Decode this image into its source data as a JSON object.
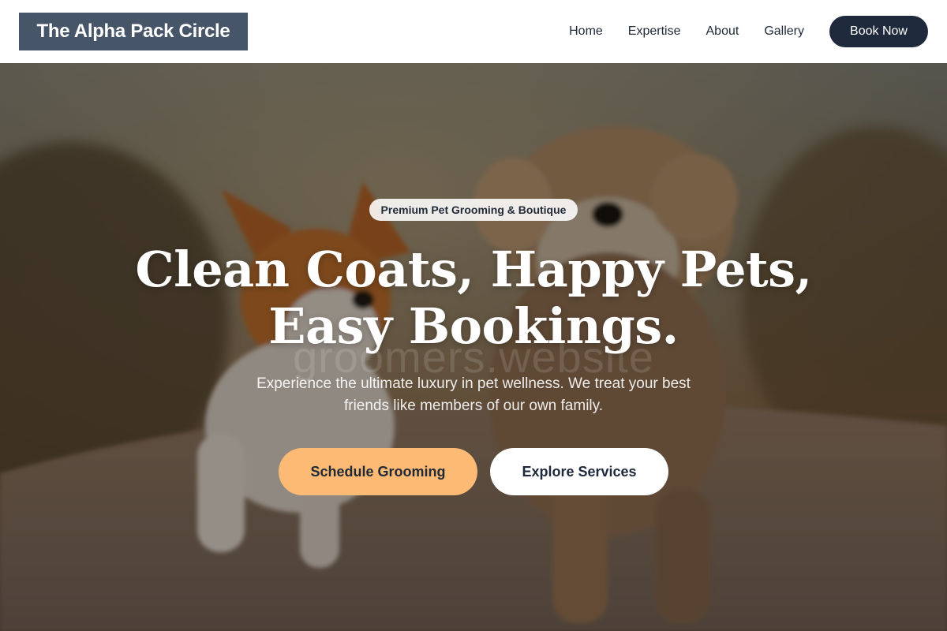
{
  "header": {
    "logo_text": "The Alpha Pack Circle",
    "nav": [
      {
        "label": "Home"
      },
      {
        "label": "Expertise"
      },
      {
        "label": "About"
      },
      {
        "label": "Gallery"
      }
    ],
    "book_label": "Book Now"
  },
  "hero": {
    "badge": "Premium Pet Grooming & Boutique",
    "headline_line1": "Clean Coats, Happy Pets,",
    "headline_line2": "Easy Bookings.",
    "watermark": "groomers.website",
    "subtitle_line1": "Experience the ultimate luxury in pet wellness. We treat your best",
    "subtitle_line2": "friends like members of our own family.",
    "primary_cta": "Schedule Grooming",
    "secondary_cta": "Explore Services",
    "image_alt": "two dogs running on a dirt path"
  },
  "colors": {
    "logo_bg": "#475569",
    "dark_navy": "#1e293b",
    "accent_peach": "#fdba74",
    "white": "#ffffff"
  }
}
